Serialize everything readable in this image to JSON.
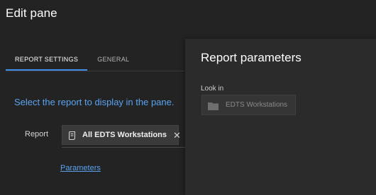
{
  "pane": {
    "title": "Edit pane"
  },
  "tabs": [
    {
      "label": "REPORT SETTINGS",
      "active": true
    },
    {
      "label": "GENERAL",
      "active": false
    }
  ],
  "report_settings": {
    "instruction": "Select the report to display in the pane.",
    "report_label": "Report",
    "selected_report": "All EDTS Workstations",
    "remove_glyph": "✕",
    "parameters_link": "Parameters"
  },
  "flyout": {
    "title": "Report parameters",
    "look_in_label": "Look in",
    "look_in_value": "EDTS Workstations",
    "look_in_icon": "folder-icon"
  },
  "colors": {
    "background": "#232323",
    "flyout_background": "#2b2b2b",
    "accent": "#3f8ee8",
    "link": "#5aa3f0"
  }
}
